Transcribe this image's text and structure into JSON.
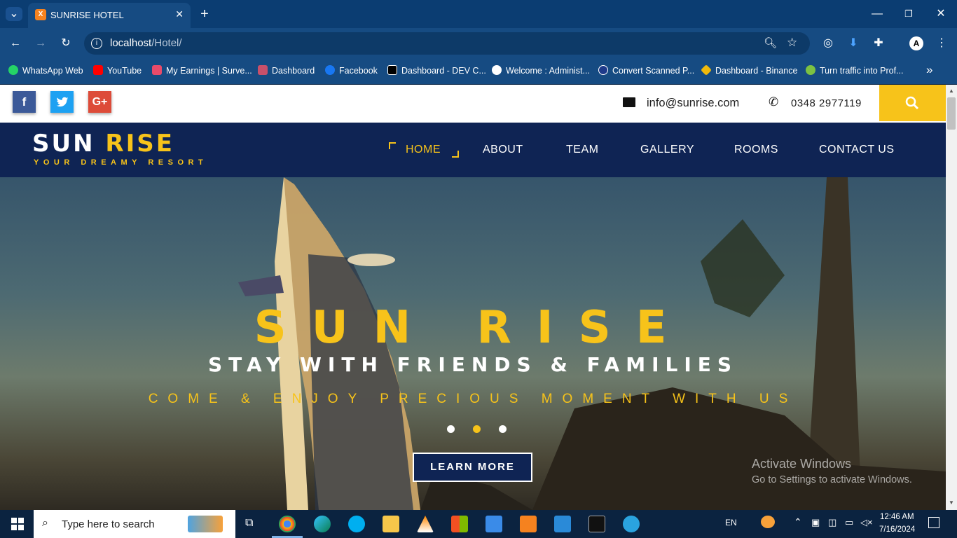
{
  "browser": {
    "tab_title": "SUNRISE HOTEL",
    "url_host": "localhost",
    "url_path": "/Hotel/",
    "bookmarks": [
      {
        "label": "WhatsApp Web",
        "color": "#25d366"
      },
      {
        "label": "YouTube",
        "color": "#ff0000"
      },
      {
        "label": "My Earnings | Surve...",
        "color": "#e94b6a"
      },
      {
        "label": "Dashboard",
        "color": "#c8506a"
      },
      {
        "label": "Facebook",
        "color": "#1877f2"
      },
      {
        "label": "Dashboard - DEV C...",
        "color": "#000000"
      },
      {
        "label": "Welcome : Administ...",
        "color": "#ffffff"
      },
      {
        "label": "Convert Scanned P...",
        "color": "#1e3a8a"
      },
      {
        "label": "Dashboard - Binance",
        "color": "#f0b90b"
      },
      {
        "label": "Turn traffic into Prof...",
        "color": "#7cc242"
      }
    ]
  },
  "site": {
    "email": "info@sunrise.com",
    "phone": "0348 2977119",
    "logo_main_a": "SUN",
    "logo_main_b": "RISE",
    "logo_tagline": "YOUR DREAMY RESORT",
    "nav": [
      "HOME",
      "ABOUT",
      "TEAM",
      "GALLERY",
      "ROOMS",
      "CONTACT US"
    ],
    "active_nav": "HOME",
    "hero": {
      "title": "SUN RISE",
      "subtitle": "STAY WITH FRIENDS & FAMILIES",
      "tagline": "COME & ENJOY PRECIOUS MOMENT WITH US",
      "button": "LEARN MORE",
      "active_slide": 2,
      "slide_count": 3
    },
    "watermark_line1": "Activate Windows",
    "watermark_line2": "Go to Settings to activate Windows.",
    "colors": {
      "accent": "#f7c31a",
      "navy": "#0f2454"
    }
  },
  "taskbar": {
    "search_placeholder": "Type here to search",
    "lang": "EN",
    "time": "12:46 AM",
    "date": "7/16/2024"
  }
}
